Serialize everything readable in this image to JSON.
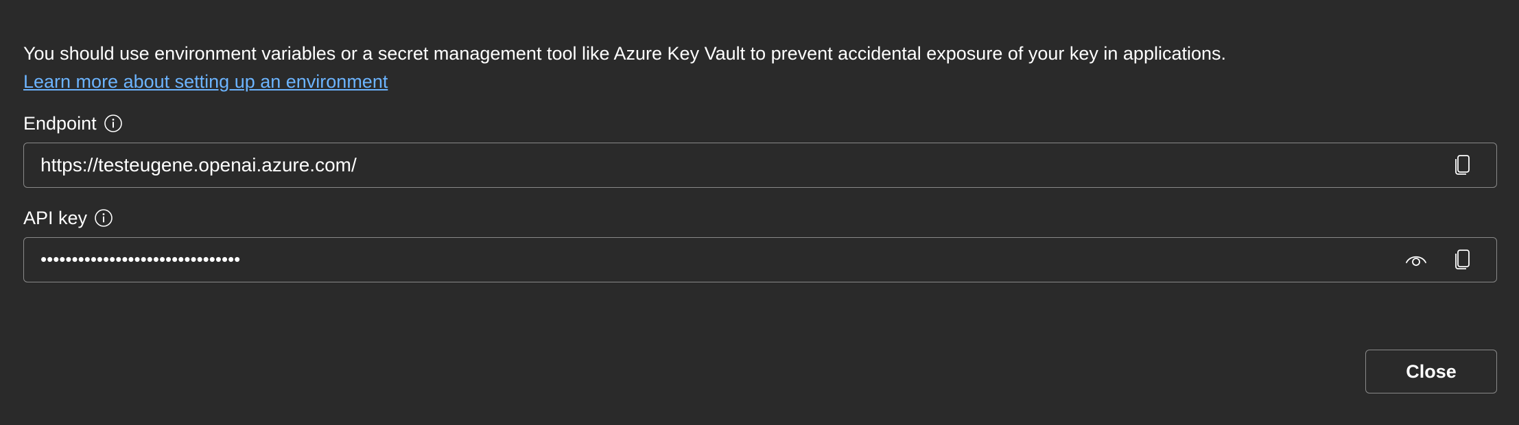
{
  "notice": {
    "text": "You should use environment variables or a secret management tool like Azure Key Vault to prevent accidental exposure of your key in applications.",
    "link_text": "Learn more about setting up an environment"
  },
  "endpoint": {
    "label": "Endpoint",
    "info_icon": "info-icon",
    "value": "https://testeugene.openai.azure.com/",
    "copy_icon": "copy-icon"
  },
  "api_key": {
    "label": "API key",
    "info_icon": "info-icon",
    "masked_value": "••••••••••••••••••••••••••••••••",
    "reveal_icon": "eye-icon",
    "copy_icon": "copy-icon"
  },
  "footer": {
    "close_label": "Close"
  }
}
